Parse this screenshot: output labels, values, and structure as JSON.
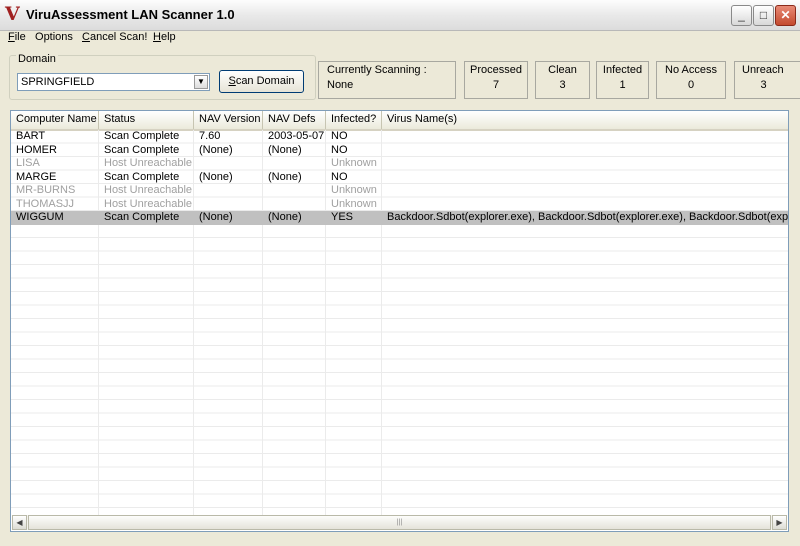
{
  "window": {
    "title": "ViruAssessment LAN Scanner 1.0",
    "app_icon": "V"
  },
  "menu": [
    {
      "key": "F",
      "rest": "ile"
    },
    {
      "key": "O",
      "rest": "ptions",
      "plain": true
    },
    {
      "key": "C",
      "rest": "ancel Scan!"
    },
    {
      "key": "H",
      "rest": "elp"
    }
  ],
  "domain": {
    "group_label": "Domain",
    "value": "SPRINGFIELD",
    "scan_button": {
      "key": "S",
      "rest": "can Domain"
    }
  },
  "status": {
    "currently_scanning": {
      "label": "Currently Scanning :",
      "value": "None"
    },
    "processed": {
      "label": "Processed",
      "value": "7"
    },
    "clean": {
      "label": "Clean",
      "value": "3"
    },
    "infected": {
      "label": "Infected",
      "value": "1"
    },
    "no_access": {
      "label": "No Access",
      "value": "0"
    },
    "unreachable": {
      "label": "Unreach",
      "value": "3"
    }
  },
  "table": {
    "columns": [
      "Computer Name",
      "Status",
      "NAV Version",
      "NAV Defs",
      "Infected?",
      "Virus Name(s)"
    ],
    "rows": [
      [
        "BART",
        "Scan Complete",
        "7.60",
        "2003-05-07",
        "NO",
        ""
      ],
      [
        "HOMER",
        "Scan Complete",
        "(None)",
        "(None)",
        "NO",
        ""
      ],
      [
        "LISA",
        "Host Unreachable",
        "",
        "",
        "Unknown",
        ""
      ],
      [
        "MARGE",
        "Scan Complete",
        "(None)",
        "(None)",
        "NO",
        ""
      ],
      [
        "MR-BURNS",
        "Host Unreachable",
        "",
        "",
        "Unknown",
        ""
      ],
      [
        "THOMASJJ",
        "Host Unreachable",
        "",
        "",
        "Unknown",
        ""
      ],
      [
        "WIGGUM",
        "Scan Complete",
        "(None)",
        "(None)",
        "YES",
        "Backdoor.Sdbot(explorer.exe), Backdoor.Sdbot(explorer.exe), Backdoor.Sdbot(explorer.exe)"
      ]
    ],
    "dim_rows": [
      2,
      4,
      5
    ],
    "selected_row": 6
  }
}
